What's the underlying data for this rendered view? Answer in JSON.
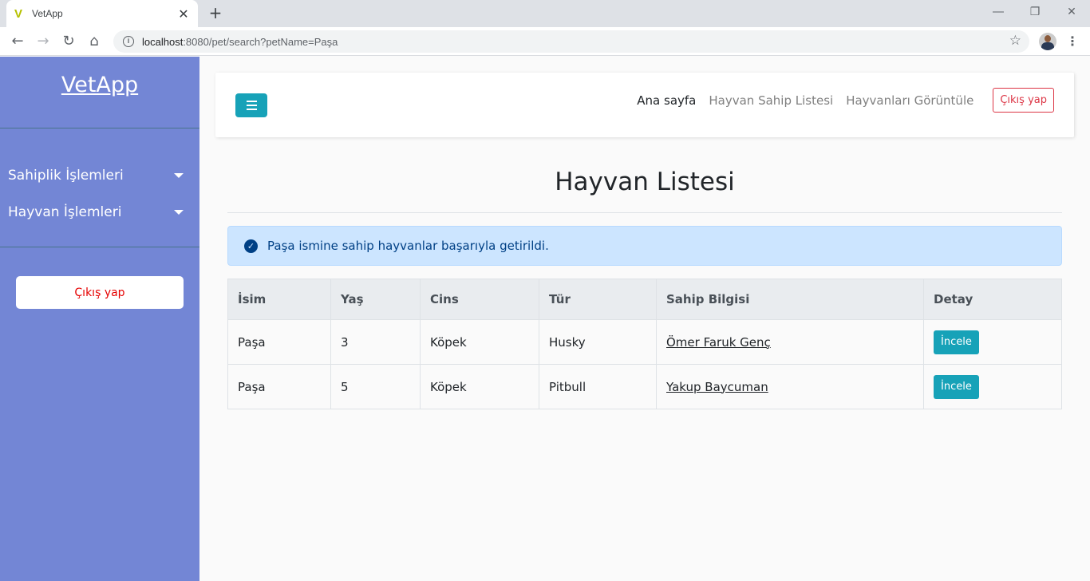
{
  "browser": {
    "tab_title": "VetApp",
    "tab_favicon": "V",
    "url_host": "localhost",
    "url_path": ":8080/pet/search?petName=Paşa",
    "icons": [
      "back-icon",
      "forward-icon",
      "reload-icon",
      "home-icon",
      "info-icon",
      "star-icon",
      "kebab-menu-icon"
    ]
  },
  "sidebar": {
    "brand": "VetApp",
    "items": [
      {
        "label": "Sahiplik İşlemleri"
      },
      {
        "label": "Hayvan İşlemleri"
      }
    ],
    "logout_label": "Çıkış yap"
  },
  "navbar": {
    "links": [
      "Ana sayfa",
      "Hayvan Sahip Listesi",
      "Hayvanları Görüntüle"
    ],
    "logout_label": "Çıkış yap"
  },
  "main": {
    "title": "Hayvan Listesi",
    "alert": "Paşa ismine sahip hayvanlar başarıyla getirildi.",
    "table": {
      "headers": [
        "İsim",
        "Yaş",
        "Cins",
        "Tür",
        "Sahip Bilgisi",
        "Detay"
      ],
      "rows": [
        {
          "name": "Paşa",
          "age": "3",
          "species": "Köpek",
          "breed": "Husky",
          "owner": "Ömer Faruk Genç",
          "action": "İncele"
        },
        {
          "name": "Paşa",
          "age": "5",
          "species": "Köpek",
          "breed": "Pitbull",
          "owner": "Yakup Baycuman",
          "action": "İncele"
        }
      ]
    }
  },
  "colors": {
    "sidebar_bg": "#7386d5",
    "accent": "#17a2b8",
    "danger": "#dc3545",
    "alert_bg": "#cce5ff"
  }
}
